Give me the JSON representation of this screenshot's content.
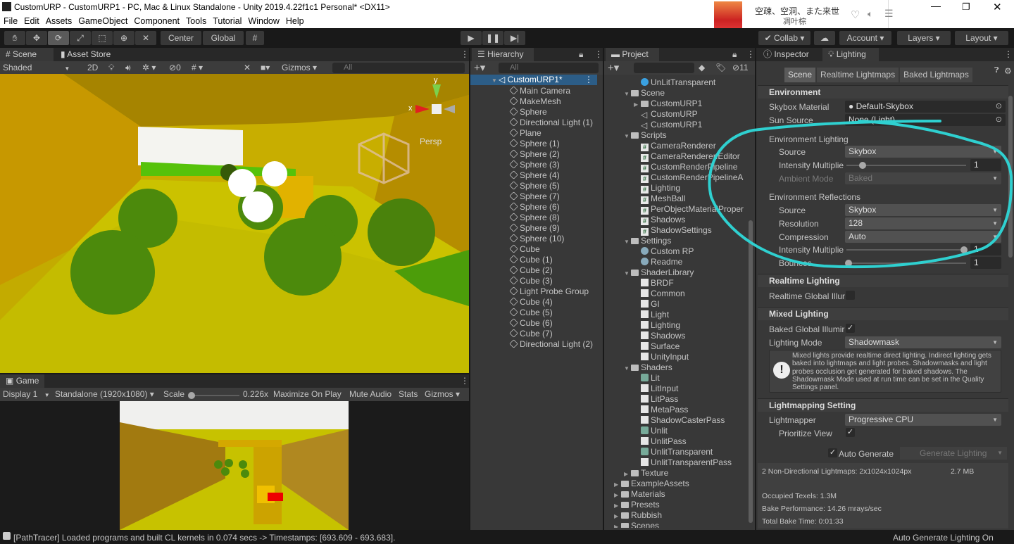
{
  "window": {
    "title": "CustomURP - CustomURP1 - PC, Mac & Linux Standalone - Unity 2019.4.22f1c1 Personal* <DX11>"
  },
  "music": {
    "song": "空疎、空洞、また来世",
    "artist": "凋叶棕"
  },
  "menu": [
    "File",
    "Edit",
    "Assets",
    "GameObject",
    "Component",
    "Tools",
    "Tutorial",
    "Window",
    "Help"
  ],
  "toolbar": {
    "pivot": "Center",
    "space": "Global",
    "collab": "Collab",
    "account": "Account",
    "layers": "Layers",
    "layout": "Layout"
  },
  "scene": {
    "tab": "Scene",
    "asset_store_tab": "Asset Store",
    "shading": "Shaded",
    "mode2d": "2D",
    "hidden_count": "0",
    "gizmos": "Gizmos",
    "search_placeholder": "All",
    "persp": "Persp",
    "axis_x": "x",
    "axis_y": "y"
  },
  "game": {
    "tab": "Game",
    "display": "Display 1",
    "resolution": "Standalone (1920x1080)",
    "scale_label": "Scale",
    "scale_value": "0.226x",
    "maximize": "Maximize On Play",
    "mute": "Mute Audio",
    "stats": "Stats",
    "gizmos": "Gizmos",
    "scale": 0.226
  },
  "hierarchy": {
    "tab": "Hierarchy",
    "search_placeholder": "All",
    "root": "CustomURP1*",
    "items": [
      "Main Camera",
      "MakeMesh",
      "Sphere",
      "Directional Light (1)",
      "Plane",
      "Sphere (1)",
      "Sphere (2)",
      "Sphere (3)",
      "Sphere (4)",
      "Sphere (5)",
      "Sphere (7)",
      "Sphere (6)",
      "Sphere (8)",
      "Sphere (9)",
      "Sphere (10)",
      "Cube",
      "Cube (1)",
      "Cube (2)",
      "Cube (3)",
      "Light Probe Group",
      "Cube (4)",
      "Cube (5)",
      "Cube (6)",
      "Cube (7)",
      "Directional Light (2)"
    ]
  },
  "project": {
    "tab": "Project",
    "hidden_count": "11",
    "items": [
      {
        "label": "UnLitTransparent",
        "depth": 2,
        "icon": "material"
      },
      {
        "label": "Scene",
        "depth": 1,
        "icon": "folder",
        "open": true
      },
      {
        "label": "CustomURP1",
        "depth": 2,
        "icon": "folder",
        "closed": true
      },
      {
        "label": "CustomURP",
        "depth": 2,
        "icon": "unity-scene"
      },
      {
        "label": "CustomURP1",
        "depth": 2,
        "icon": "unity-scene"
      },
      {
        "label": "Scripts",
        "depth": 1,
        "icon": "folder",
        "open": true
      },
      {
        "label": "CameraRenderer",
        "depth": 2,
        "icon": "script"
      },
      {
        "label": "CameraRenderer.Editor",
        "depth": 2,
        "icon": "script"
      },
      {
        "label": "CustomRenderPipeline",
        "depth": 2,
        "icon": "script"
      },
      {
        "label": "CustomRenderPipelineA",
        "depth": 2,
        "icon": "script"
      },
      {
        "label": "Lighting",
        "depth": 2,
        "icon": "script"
      },
      {
        "label": "MeshBall",
        "depth": 2,
        "icon": "script"
      },
      {
        "label": "PerObjectMaterialProper",
        "depth": 2,
        "icon": "script"
      },
      {
        "label": "Shadows",
        "depth": 2,
        "icon": "script"
      },
      {
        "label": "ShadowSettings",
        "depth": 2,
        "icon": "script"
      },
      {
        "label": "Settings",
        "depth": 1,
        "icon": "folder",
        "open": true
      },
      {
        "label": "Custom RP",
        "depth": 2,
        "icon": "asset"
      },
      {
        "label": "Readme",
        "depth": 2,
        "icon": "asset"
      },
      {
        "label": "ShaderLibrary",
        "depth": 1,
        "icon": "folder",
        "open": true
      },
      {
        "label": "BRDF",
        "depth": 2,
        "icon": "file"
      },
      {
        "label": "Common",
        "depth": 2,
        "icon": "file"
      },
      {
        "label": "GI",
        "depth": 2,
        "icon": "file"
      },
      {
        "label": "Light",
        "depth": 2,
        "icon": "file"
      },
      {
        "label": "Lighting",
        "depth": 2,
        "icon": "file"
      },
      {
        "label": "Shadows",
        "depth": 2,
        "icon": "file"
      },
      {
        "label": "Surface",
        "depth": 2,
        "icon": "file"
      },
      {
        "label": "UnityInput",
        "depth": 2,
        "icon": "file"
      },
      {
        "label": "Shaders",
        "depth": 1,
        "icon": "folder",
        "open": true
      },
      {
        "label": "Lit",
        "depth": 2,
        "icon": "shader"
      },
      {
        "label": "LitInput",
        "depth": 2,
        "icon": "file"
      },
      {
        "label": "LitPass",
        "depth": 2,
        "icon": "file"
      },
      {
        "label": "MetaPass",
        "depth": 2,
        "icon": "file"
      },
      {
        "label": "ShadowCasterPass",
        "depth": 2,
        "icon": "file"
      },
      {
        "label": "Unlit",
        "depth": 2,
        "icon": "shader"
      },
      {
        "label": "UnlitPass",
        "depth": 2,
        "icon": "file"
      },
      {
        "label": "UnlitTransparent",
        "depth": 2,
        "icon": "shader"
      },
      {
        "label": "UnlitTransparentPass",
        "depth": 2,
        "icon": "file"
      },
      {
        "label": "Texture",
        "depth": 1,
        "icon": "folder",
        "closed": true
      },
      {
        "label": "ExampleAssets",
        "depth": 0,
        "icon": "folder",
        "closed": true
      },
      {
        "label": "Materials",
        "depth": 0,
        "icon": "folder",
        "closed": true
      },
      {
        "label": "Presets",
        "depth": 0,
        "icon": "folder",
        "closed": true
      },
      {
        "label": "Rubbish",
        "depth": 0,
        "icon": "folder",
        "closed": true
      },
      {
        "label": "Scenes",
        "depth": 0,
        "icon": "folder",
        "closed": true
      }
    ]
  },
  "inspector": {
    "tab": "Inspector",
    "lighting_tab": "Lighting",
    "subtabs": [
      "Scene",
      "Realtime Lightmaps",
      "Baked Lightmaps"
    ],
    "environment": {
      "title": "Environment",
      "skybox_label": "Skybox Material",
      "skybox_value": "Default-Skybox",
      "sun_label": "Sun Source",
      "sun_value": "None (Light)",
      "env_lighting": "Environment Lighting",
      "source_label": "Source",
      "source_value": "Skybox",
      "intensity_label": "Intensity Multiplie",
      "intensity_value": "1",
      "intensity": 1,
      "ambient_label": "Ambient Mode",
      "ambient_value": "Baked",
      "env_reflections": "Environment Reflections",
      "r_source_label": "Source",
      "r_source_value": "Skybox",
      "resolution_label": "Resolution",
      "resolution_value": "128",
      "compression_label": "Compression",
      "compression_value": "Auto",
      "r_intensity_label": "Intensity Multiplie",
      "r_intensity_value": "1",
      "r_intensity": 1,
      "bounces_label": "Bounces",
      "bounces_value": "1",
      "bounces": 1
    },
    "realtime": {
      "title": "Realtime Lighting",
      "gi_label": "Realtime Global Illur",
      "gi_checked": false
    },
    "mixed": {
      "title": "Mixed Lighting",
      "baked_label": "Baked Global Illumir",
      "baked_checked": true,
      "mode_label": "Lighting Mode",
      "mode_value": "Shadowmask",
      "help": "Mixed lights provide realtime direct lighting. Indirect lighting gets baked into lightmaps and light probes. Shadowmasks and light probes occlusion get generated for baked shadows. The Shadowmask Mode used at run time can be set in the Quality Settings panel."
    },
    "lightmapping": {
      "title": "Lightmapping Setting",
      "lightmapper_label": "Lightmapper",
      "lightmapper_value": "Progressive CPU",
      "prioritize_label": "Prioritize View",
      "prioritize_checked": true
    },
    "auto_generate": "Auto Generate",
    "generate_button": "Generate Lighting",
    "stats": {
      "lightmaps": "2 Non-Directional Lightmaps: 2x1024x1024px",
      "size": "2.7 MB",
      "texels": "Occupied Texels: 1.3M",
      "performance": "Bake Performance: 14.26 mrays/sec",
      "time": "Total Bake Time: 0:01:33"
    }
  },
  "status": {
    "message": "[PathTracer] Loaded programs and built CL kernels in 0.074 secs -> Timestamps: [693.609 - 693.683].",
    "right": "Auto Generate Lighting On"
  },
  "colors": {
    "panel": "#383838",
    "annotation": "#2fd0d0",
    "scene_yellow": "#c8b400",
    "sphere_green": "#4c8a0c"
  }
}
